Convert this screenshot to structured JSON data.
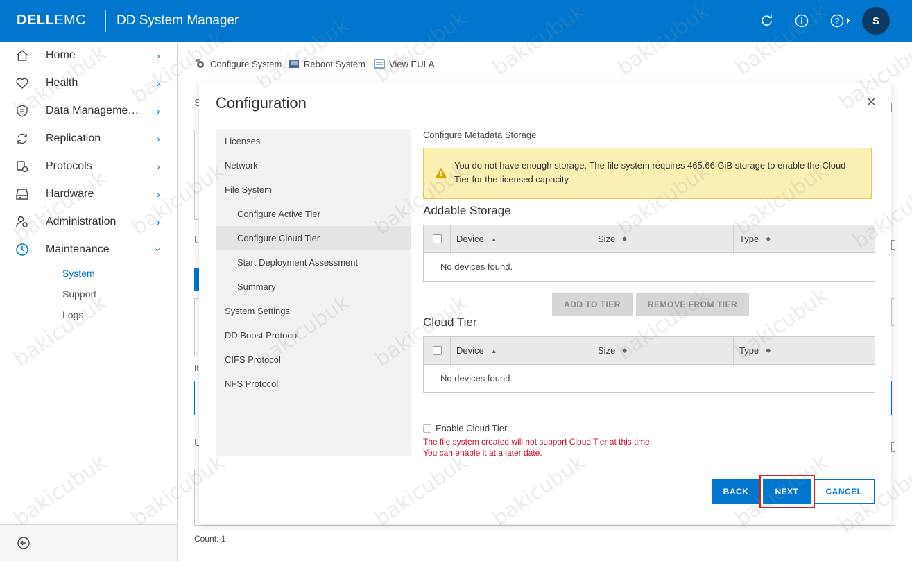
{
  "header": {
    "logo_dell": "DELL",
    "logo_emc": "EMC",
    "app_title": "DD System Manager",
    "user_initial": "S",
    "icons": [
      "refresh-icon",
      "info-icon",
      "help-icon"
    ]
  },
  "sidebar": {
    "items": [
      {
        "label": "Home",
        "icon": "home-icon"
      },
      {
        "label": "Health",
        "icon": "heart-icon"
      },
      {
        "label": "Data Manageme…",
        "icon": "shield-icon"
      },
      {
        "label": "Replication",
        "icon": "sync-icon"
      },
      {
        "label": "Protocols",
        "icon": "protocols-icon"
      },
      {
        "label": "Hardware",
        "icon": "drive-icon"
      },
      {
        "label": "Administration",
        "icon": "admin-icon"
      },
      {
        "label": "Maintenance",
        "icon": "clock-icon"
      }
    ],
    "sub_items": [
      "System",
      "Support",
      "Logs"
    ]
  },
  "toolbar": {
    "configure": "Configure System",
    "reboot": "Reboot System",
    "eula": "View EULA"
  },
  "background": {
    "frag_s": "S",
    "frag_u1": "U",
    "frag_it": "It",
    "frag_u2": "U",
    "count": "Count: 1"
  },
  "modal": {
    "title": "Configuration",
    "close": "×",
    "steps": [
      {
        "label": "Licenses",
        "level": 1
      },
      {
        "label": "Network",
        "level": 1
      },
      {
        "label": "File System",
        "level": 1
      },
      {
        "label": "Configure Active Tier",
        "level": 2
      },
      {
        "label": "Configure Cloud Tier",
        "level": 2,
        "current": true
      },
      {
        "label": "Start Deployment Assessment",
        "level": 2
      },
      {
        "label": "Summary",
        "level": 2
      },
      {
        "label": "System Settings",
        "level": 1
      },
      {
        "label": "DD Boost Protocol",
        "level": 1
      },
      {
        "label": "CIFS Protocol",
        "level": 1
      },
      {
        "label": "NFS Protocol",
        "level": 1
      }
    ],
    "metadata_label": "Configure Metadata Storage",
    "warning": "You do not have enough storage. The file system requires 465.66 GiB storage to enable the Cloud Tier for the licensed capacity.",
    "addable_title": "Addable Storage",
    "cloud_title": "Cloud Tier",
    "columns": {
      "device": "Device",
      "size": "Size",
      "type": "Type"
    },
    "empty_text": "No devices found.",
    "add_to_tier": "ADD TO TIER",
    "remove_from_tier": "REMOVE FROM TIER",
    "enable_cloud_tier": "Enable Cloud Tier",
    "error_line1": "The file system created will not support Cloud Tier at this time.",
    "error_line2": "You can enable it at a later date.",
    "back": "BACK",
    "next": "NEXT",
    "cancel": "CANCEL"
  },
  "watermark": "bakicubuk",
  "colors": {
    "brand": "#0076ce",
    "warning_bg": "#faf0b4",
    "error": "#c8102e",
    "highlight": "#e01b1b"
  }
}
